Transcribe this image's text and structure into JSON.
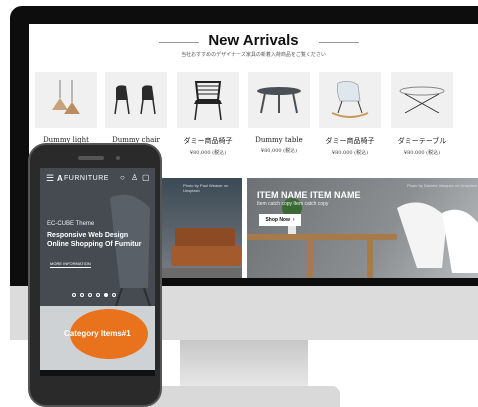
{
  "desktop": {
    "section_title": "New Arrivals",
    "section_subtitle": "当社おすすめのデザイナーズ家具の新着入荷商品をご覧ください",
    "products": [
      {
        "name": "Dummy light",
        "price": "",
        "icon": "pendant-lamp-icon"
      },
      {
        "name": "Dummy chair",
        "price": "",
        "icon": "chair-pair-icon"
      },
      {
        "name": "ダミー商品椅子",
        "price": "¥80,000 (税込)",
        "icon": "wire-chair-icon"
      },
      {
        "name": "Dummy table",
        "price": "¥80,000 (税込)",
        "icon": "round-table-icon"
      },
      {
        "name": "ダミー商品椅子",
        "price": "¥80,000 (税込)",
        "icon": "rocking-chair-icon"
      },
      {
        "name": "ダミーテーブル",
        "price": "¥80,000 (税込)",
        "icon": "glass-table-icon"
      }
    ],
    "banner_mid_credit": "Photo by Paul Weaver on Unsplash",
    "banner_right": {
      "credit": "Photo by Daniela Vasquez on Unsplash",
      "title": "ITEM NAME ITEM NAME",
      "copy": "Item catch copy Item catch copy",
      "button_label": "Shop Now"
    },
    "to_top_label": "^"
  },
  "phone": {
    "logo_text": "FURNITURE",
    "hero_theme": "EC-CUBE Theme",
    "hero_line1": "Responsive Web Design",
    "hero_line2": "Online Shopping Of Furnitur",
    "more_info": "MORE INFORMATION",
    "slide_count": 6,
    "active_slide": 5,
    "category_label": "Category Items#1"
  },
  "colors": {
    "accent": "#e9731c",
    "bezel": "#0d0d0d"
  }
}
